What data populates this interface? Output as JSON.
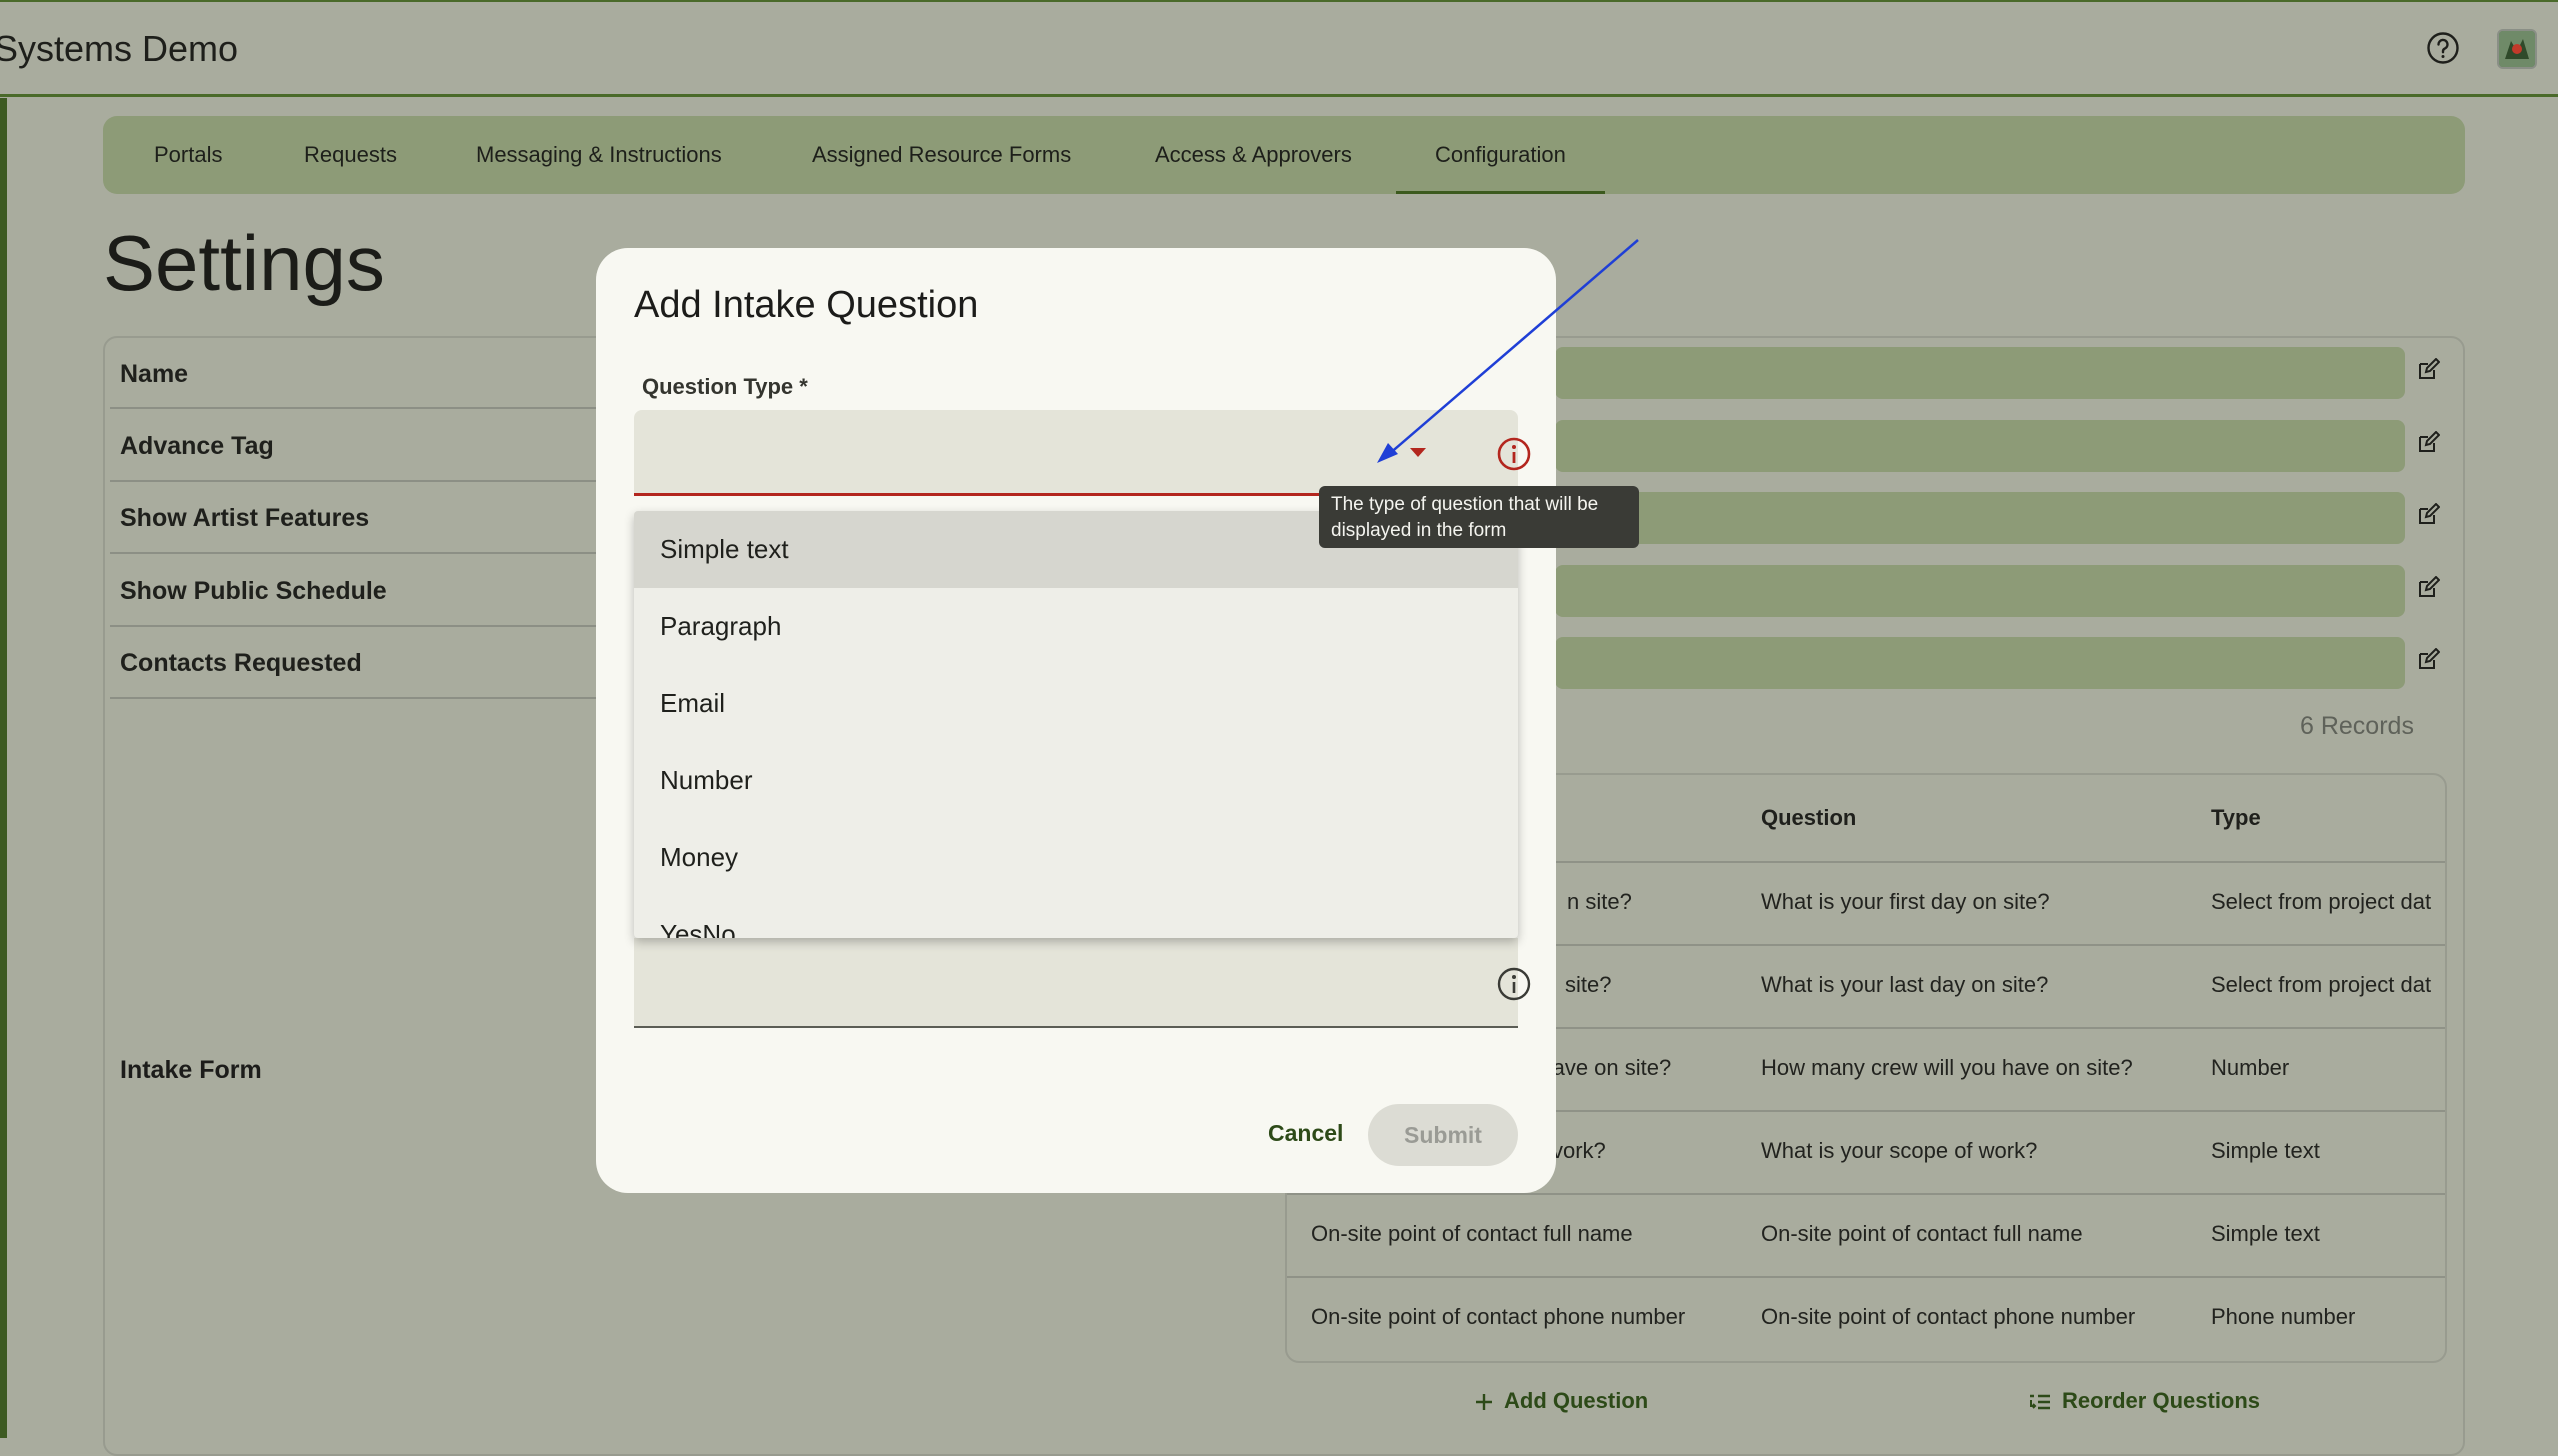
{
  "app": {
    "title": "Systems Demo"
  },
  "tabs": [
    {
      "label": "Portals"
    },
    {
      "label": "Requests"
    },
    {
      "label": "Messaging & Instructions"
    },
    {
      "label": "Assigned Resource Forms"
    },
    {
      "label": "Access & Approvers"
    },
    {
      "label": "Configuration",
      "active": true
    }
  ],
  "page": {
    "title": "Settings"
  },
  "settings": {
    "rows": [
      {
        "label": "Name"
      },
      {
        "label": "Advance Tag"
      },
      {
        "label": "Show Artist Features"
      },
      {
        "label": "Show Public Schedule"
      },
      {
        "label": "Contacts Requested"
      }
    ],
    "intake_label": "Intake Form",
    "records": "6 Records"
  },
  "intake_table": {
    "headers": [
      "Question",
      "Type"
    ],
    "rows": [
      {
        "partial": "n site?",
        "question": "What is your first day on site?",
        "type": "Select from project dat"
      },
      {
        "partial": "site?",
        "question": "What is your last day on site?",
        "type": "Select from project dat"
      },
      {
        "partial": "u have on site?",
        "question": "How many crew will you have on site?",
        "type": "Number"
      },
      {
        "partial": "vork?",
        "question": "What is your scope of work?",
        "type": "Simple text"
      },
      {
        "partial": "On-site point of contact full name",
        "question": "On-site point of contact full name",
        "type": "Simple text"
      },
      {
        "partial": "On-site point of contact phone number",
        "question": "On-site point of contact phone number",
        "type": "Phone number"
      }
    ],
    "add_question": "Add Question",
    "reorder_questions": "Reorder Questions"
  },
  "dialog": {
    "title": "Add Intake Question",
    "question_type_label": "Question Type *",
    "cancel": "Cancel",
    "submit": "Submit"
  },
  "dropdown": {
    "options": [
      "Simple text",
      "Paragraph",
      "Email",
      "Number",
      "Money",
      "YesNo"
    ],
    "highlighted": "Simple text"
  },
  "tooltip": {
    "line1": "The type of question that will be",
    "line2": "displayed in the form"
  },
  "colors": {
    "accent_green": "#3c5a1e",
    "error_red": "#b3261e",
    "annotation_blue": "#1f3fd6"
  }
}
